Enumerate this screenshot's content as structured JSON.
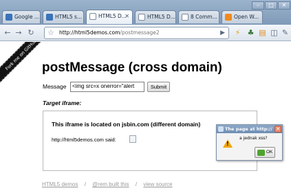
{
  "browser": {
    "tabs": [
      {
        "label": "Google ...",
        "favicon_color": "#3b73b9"
      },
      {
        "label": "HTML5 s...",
        "favicon_color": "#3b73b9"
      },
      {
        "label": "HTML5 D...",
        "favicon_color": "#ffffff"
      },
      {
        "label": "HTML5 D...",
        "favicon_color": "#ffffff"
      },
      {
        "label": "8 Comm...",
        "favicon_color": "#ffffff"
      },
      {
        "label": "Open W...",
        "favicon_color": "#f08a1c"
      }
    ],
    "url_host": "http://html5demos.com",
    "url_path": "/postmessage2"
  },
  "page": {
    "ribbon": "Fork me on GitHub",
    "title": "postMessage (cross domain)",
    "message_label": "Message",
    "message_value": "<img src=x onerror=\"alert",
    "submit_label": "Submit",
    "target_label": "Target iframe:",
    "iframe_heading": "This iframe is located on jsbin.com (different domain)",
    "iframe_text": "http://html5demos.com said:",
    "footer": {
      "link1": "HTML5 demos",
      "sep": "/",
      "link2": "@rem built this",
      "link3": "view source"
    }
  },
  "dialog": {
    "title": "The page at http://",
    "message": "a jednak xss?",
    "ok_label": "OK"
  },
  "colors": {
    "chrome_frame": "#8aa4c1",
    "warning": "#f0a400",
    "ok_green": "#4ea32e"
  }
}
